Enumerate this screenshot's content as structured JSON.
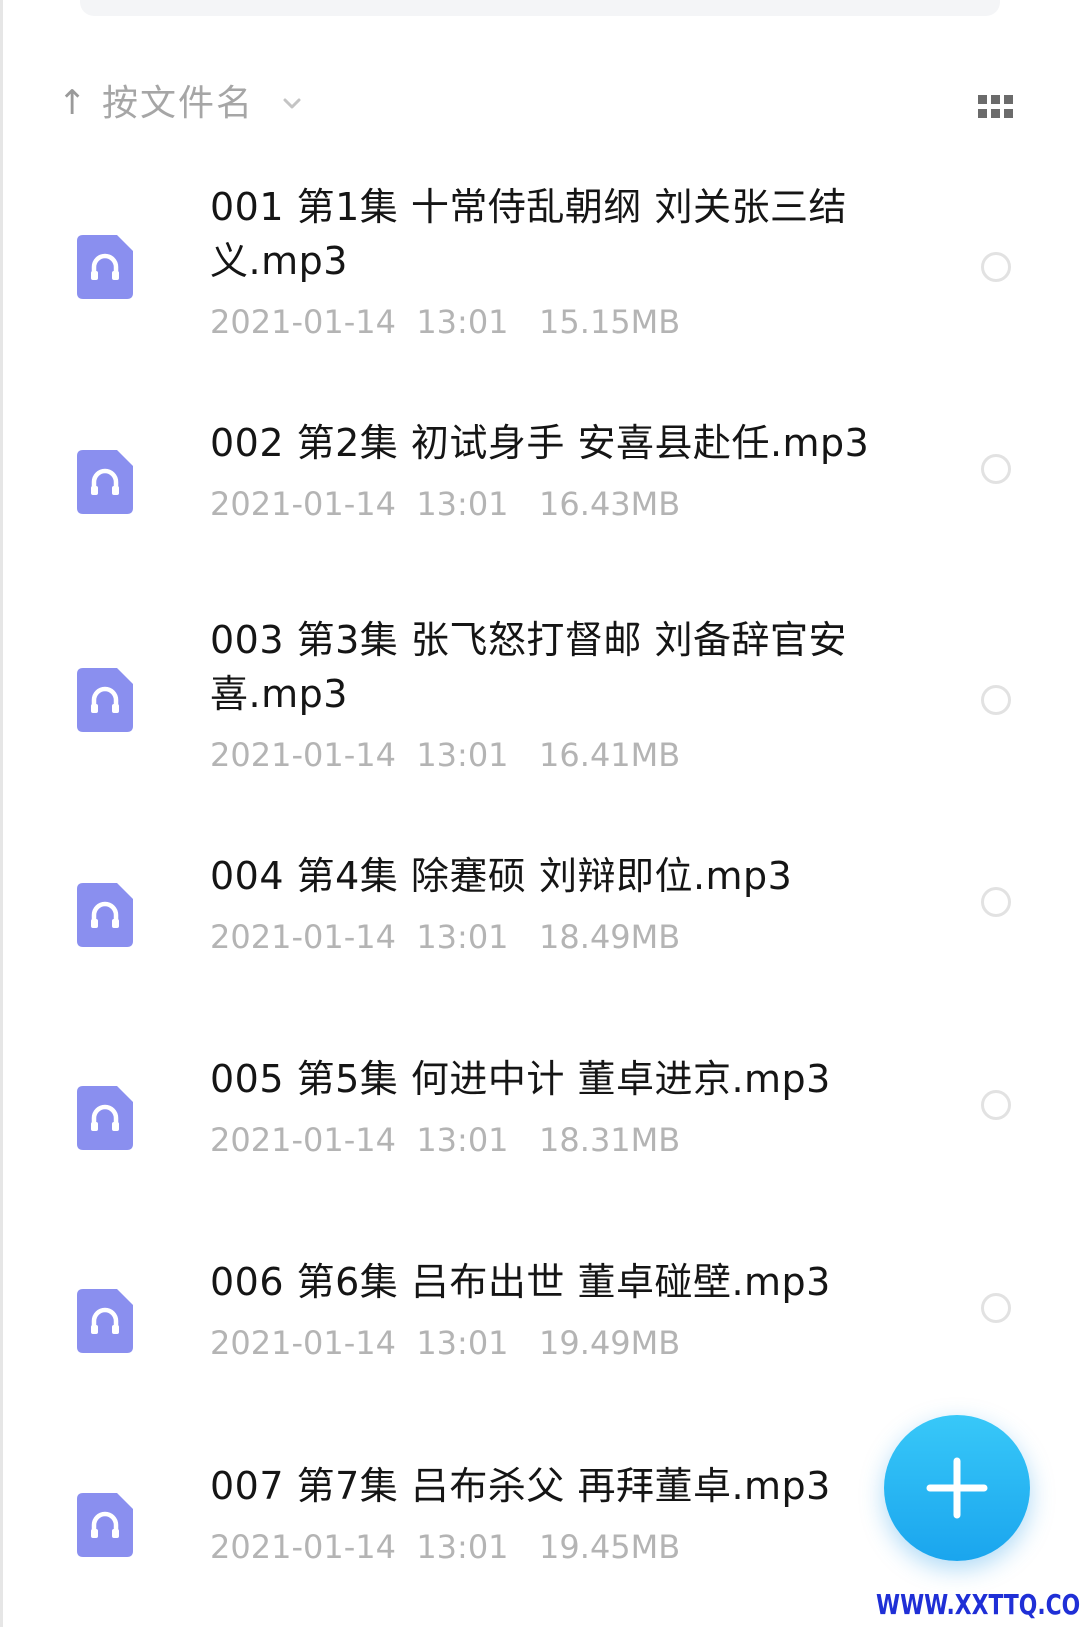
{
  "sort": {
    "arrow": "↑",
    "label": "按文件名"
  },
  "icons": {
    "sort_direction": "arrow-up-icon",
    "sort_dropdown": "chevron-down-icon",
    "view_toggle": "grid-view-icon",
    "file_type": "audio-file-icon",
    "fab": "plus-icon"
  },
  "colors": {
    "file_icon": "#8a8fef",
    "fab": "#1fb0f2",
    "watermark": "#1f2fd6"
  },
  "files": [
    {
      "name": "001 第1集 十常侍乱朝纲 刘关张三结义.mp3",
      "date": "2021-01-14",
      "time": "13:01",
      "size": "15.15MB"
    },
    {
      "name": "002 第2集 初试身手 安喜县赴任.mp3",
      "date": "2021-01-14",
      "time": "13:01",
      "size": "16.43MB"
    },
    {
      "name": "003 第3集 张飞怒打督邮 刘备辞官安喜.mp3",
      "date": "2021-01-14",
      "time": "13:01",
      "size": "16.41MB"
    },
    {
      "name": "004 第4集 除蹇硕 刘辩即位.mp3",
      "date": "2021-01-14",
      "time": "13:01",
      "size": "18.49MB"
    },
    {
      "name": "005 第5集 何进中计 董卓进京.mp3",
      "date": "2021-01-14",
      "time": "13:01",
      "size": "18.31MB"
    },
    {
      "name": "006 第6集 吕布出世 董卓碰壁.mp3",
      "date": "2021-01-14",
      "time": "13:01",
      "size": "19.49MB"
    },
    {
      "name": "007 第7集 吕布杀父 再拜董卓.mp3",
      "date": "2021-01-14",
      "time": "13:01",
      "size": "19.45MB"
    }
  ],
  "watermark": "WWW.XXTTQ.COM"
}
